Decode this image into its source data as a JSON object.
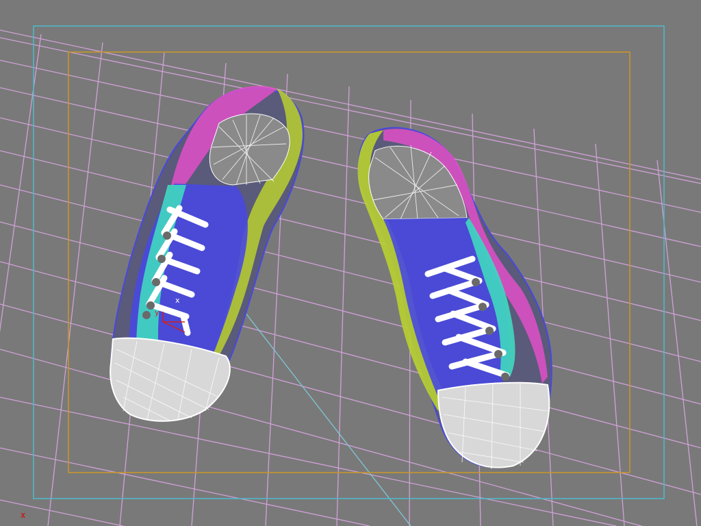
{
  "viewport": {
    "name": "perspective-viewport",
    "background": "#797979",
    "grid_color": "#d8a0e0",
    "safe_frame_outer_color": "#4fb8c8",
    "safe_frame_inner_color": "#c8962a",
    "corner_marker": "x"
  },
  "objects": [
    {
      "name": "left-shoe",
      "colors": {
        "heel": "#e050c8",
        "side": "#b8d030",
        "vamp": "#4848e0",
        "eyelet_panel": "#40d8c0",
        "toe_cap": "#ffffff",
        "laces": "#ffffff",
        "eyelets": "#606060"
      }
    },
    {
      "name": "right-shoe",
      "colors": {
        "heel": "#e050c8",
        "side": "#b8d030",
        "vamp": "#4848e0",
        "eyelet_panel": "#40d8c0",
        "toe_cap": "#ffffff",
        "laces": "#ffffff",
        "eyelets": "#606060"
      }
    }
  ],
  "gizmo": {
    "name": "pivot-gizmo",
    "axis_label_y": "y",
    "axis_label_x": "x",
    "x_color": "#d02020",
    "y_color": "#d02020"
  }
}
